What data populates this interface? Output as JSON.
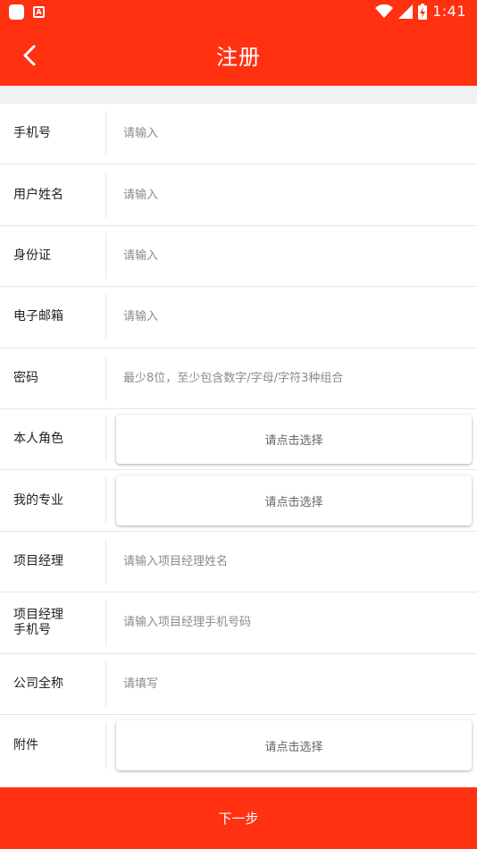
{
  "status_bar": {
    "time": "1:41",
    "icons": [
      "app-square-icon",
      "font-a-icon",
      "wifi-icon",
      "signal-icon",
      "battery-charging-icon"
    ]
  },
  "header": {
    "title": "注册",
    "back_icon": "chevron-left-icon"
  },
  "form": {
    "phone": {
      "label": "手机号",
      "placeholder": "请输入"
    },
    "username": {
      "label": "用户姓名",
      "placeholder": "请输入"
    },
    "id_card": {
      "label": "身份证",
      "placeholder": "请输入"
    },
    "email": {
      "label": "电子邮箱",
      "placeholder": "请输入"
    },
    "password": {
      "label": "密码",
      "placeholder": "最少8位，至少包含数字/字母/字符3种组合"
    },
    "role": {
      "label": "本人角色",
      "button": "请点击选择"
    },
    "major": {
      "label": "我的专业",
      "button": "请点击选择"
    },
    "pm_name": {
      "label": "项目经理",
      "placeholder": "请输入项目经理姓名"
    },
    "pm_phone": {
      "label_line1": "项目经理",
      "label_line2": "手机号",
      "placeholder": "请输入项目经理手机号码"
    },
    "company": {
      "label": "公司全称",
      "placeholder": "请填写"
    },
    "attachment": {
      "label": "附件",
      "button": "请点击选择"
    }
  },
  "footer": {
    "next_label": "下一步"
  },
  "colors": {
    "brand": "#ff3111",
    "background": "#ffffff",
    "section_gap": "#f1f1f4"
  }
}
